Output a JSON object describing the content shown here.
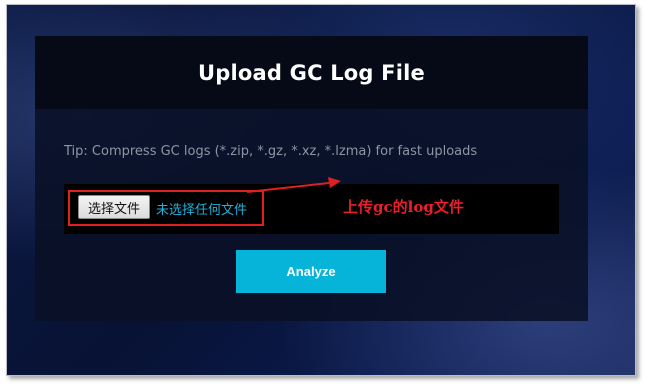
{
  "panel": {
    "title": "Upload GC Log File",
    "tip": "Tip: Compress GC logs (*.zip, *.gz, *.xz, *.lzma) for fast uploads"
  },
  "file_input": {
    "button_label": "选择文件",
    "status_text": "未选择任何文件"
  },
  "annotation": {
    "text": "上传gc的log文件",
    "color": "#e8202a"
  },
  "analyze_button": {
    "label": "Analyze",
    "color": "#06b3d9"
  }
}
